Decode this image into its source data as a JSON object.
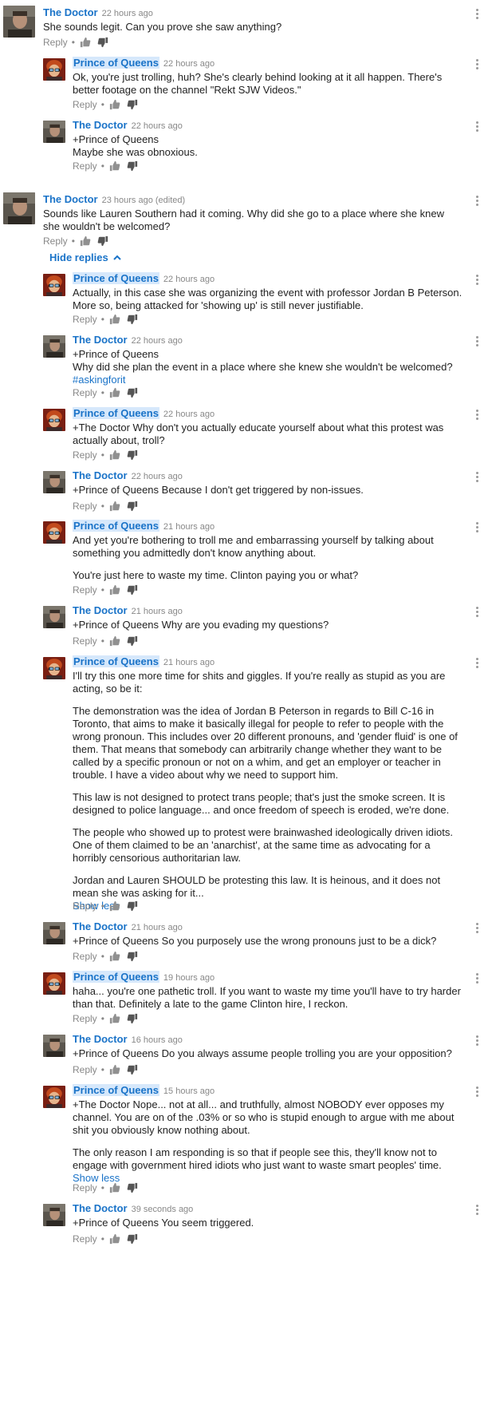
{
  "labels": {
    "reply": "Reply",
    "show_less": "Show less",
    "hide_replies": "Hide replies"
  },
  "comments": [
    {
      "author": "The Doctor",
      "time": "22 hours ago",
      "paras": [
        "She sounds legit. Can you prove she saw anything?"
      ]
    },
    {
      "author": "Prince of Queens",
      "time": "22 hours ago",
      "paras": [
        "Ok, you're just trolling, huh? She's clearly behind looking at it all happen. There's better footage on the channel \"Rekt SJW Videos.\""
      ]
    },
    {
      "author": "The Doctor",
      "time": "22 hours ago",
      "paras": [
        "+Prince of Queens\nMaybe she was obnoxious."
      ]
    },
    {
      "author": "The Doctor",
      "time": "23 hours ago (edited)",
      "paras": [
        "Sounds like Lauren Southern had it coming. Why did she go to a place where she knew she wouldn't be welcomed?"
      ]
    },
    {
      "author": "Prince of Queens",
      "time": "22 hours ago",
      "paras": [
        "Actually, in this case she was organizing the event with professor Jordan B Peterson. More so, being attacked for 'showing up' is still never justifiable."
      ]
    },
    {
      "author": "The Doctor",
      "time": "22 hours ago",
      "paras": [
        "+Prince of Queens\nWhy did she plan the event in a place where she knew she wouldn't be welcomed?"
      ],
      "hashtag": "#askingforit"
    },
    {
      "author": "Prince of Queens",
      "time": "22 hours ago",
      "paras": [
        "+The Doctor Why don't you actually educate yourself about what this protest was actually about, troll?"
      ]
    },
    {
      "author": "The Doctor",
      "time": "22 hours ago",
      "paras": [
        "+Prince of Queens Because I don't get triggered by non-issues."
      ]
    },
    {
      "author": "Prince of Queens",
      "time": "21 hours ago",
      "paras": [
        "And yet you're bothering to troll me and embarrassing yourself by talking about something you admittedly don't know anything about.",
        "You're just here to waste my time. Clinton paying you or what?"
      ]
    },
    {
      "author": "The Doctor",
      "time": "21 hours ago",
      "paras": [
        "+Prince of Queens Why are you evading my questions?"
      ]
    },
    {
      "author": "Prince of Queens",
      "time": "21 hours ago",
      "paras": [
        "I'll try this one more time for shits and giggles. If you're really as stupid as you are acting, so be it:",
        "The demonstration was the idea of Jordan B Peterson in regards to Bill C-16 in Toronto, that aims to make it basically illegal for people to refer to people with the wrong pronoun. This includes over 20 different pronouns, and 'gender fluid' is one of them. That means that somebody can arbitrarily change whether they want to be called by a specific pronoun or not on a whim, and get an employer or teacher in trouble. I have a video about why we need to support him.",
        "This law is not designed to protect trans people; that's just the smoke screen. It is designed to police language... and once freedom of speech is eroded, we're done.",
        "The people who showed up to protest were brainwashed ideologically driven idiots. One of them claimed to be an 'anarchist', at the same time as advocating for a horribly censorious authoritarian law.",
        "Jordan and Lauren SHOULD be protesting this law. It is heinous, and it does not mean she was asking for it..."
      ],
      "show_less": true
    },
    {
      "author": "The Doctor",
      "time": "21 hours ago",
      "paras": [
        "+Prince of Queens So you purposely use the wrong pronouns just to be a dick?"
      ]
    },
    {
      "author": "Prince of Queens",
      "time": "19 hours ago",
      "paras": [
        "haha... you're one pathetic troll. If you want to waste my time you'll have to try harder than that. Definitely a late to the game Clinton hire, I reckon."
      ]
    },
    {
      "author": "The Doctor",
      "time": "16 hours ago",
      "paras": [
        "+Prince of Queens Do you always assume people trolling you are your opposition?"
      ]
    },
    {
      "author": "Prince of Queens",
      "time": "15 hours ago",
      "paras": [
        "+The Doctor Nope... not at all... and truthfully, almost NOBODY ever opposes my channel. You are on of the .03% or so who is stupid enough to argue with me about shit you obviously know nothing about.",
        "The only reason I am responding is so that if people see this, they'll know not to engage with government hired idiots who just want to waste smart peoples' time."
      ],
      "show_less": true
    },
    {
      "author": "The Doctor",
      "time": "39 seconds ago",
      "paras": [
        "+Prince of Queens You seem triggered."
      ]
    }
  ]
}
